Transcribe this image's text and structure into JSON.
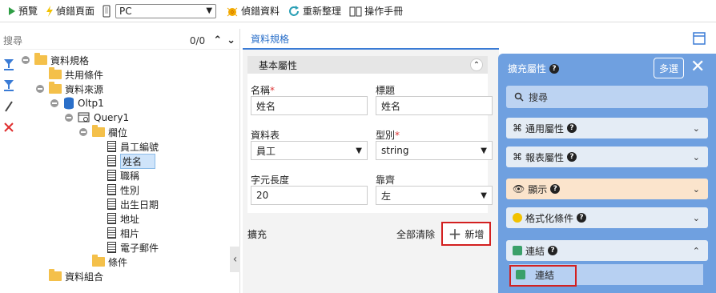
{
  "toolbar": {
    "preview": "預覽",
    "debug_page": "偵錯頁面",
    "device": "PC",
    "debug_data": "偵錯資料",
    "reorganize": "重新整理",
    "manual": "操作手冊"
  },
  "left": {
    "search_placeholder": "搜尋",
    "count": "0/0",
    "tree": {
      "data_spec": "資料規格",
      "shared_cond": "共用條件",
      "data_source": "資料來源",
      "oltp": "Oltp1",
      "query": "Query1",
      "fields": "欄位",
      "f1": "員工編號",
      "f2": "姓名",
      "f3": "職稱",
      "f4": "性別",
      "f5": "出生日期",
      "f6": "地址",
      "f7": "相片",
      "f8": "電子郵件",
      "conditions": "條件",
      "data_combo": "資料組合"
    }
  },
  "mid": {
    "tab": "資料規格",
    "group": "基本屬性",
    "name_label": "名稱",
    "name_value": "姓名",
    "title_label": "標題",
    "title_value": "姓名",
    "table_label": "資料表",
    "table_value": "員工",
    "type_label": "型別",
    "type_value": "string",
    "length_label": "字元長度",
    "length_value": "20",
    "align_label": "靠齊",
    "align_value": "左",
    "required_mark": "*",
    "expand_label": "擴充",
    "clear_all": "全部清除",
    "add": "新增"
  },
  "right": {
    "title": "擴充屬性",
    "multi": "多選",
    "search_placeholder": "搜尋",
    "common_props": "通用屬性",
    "report_props": "報表屬性",
    "display": "顯示",
    "format_cond": "格式化條件",
    "link": "連結",
    "link_item": "連結"
  }
}
